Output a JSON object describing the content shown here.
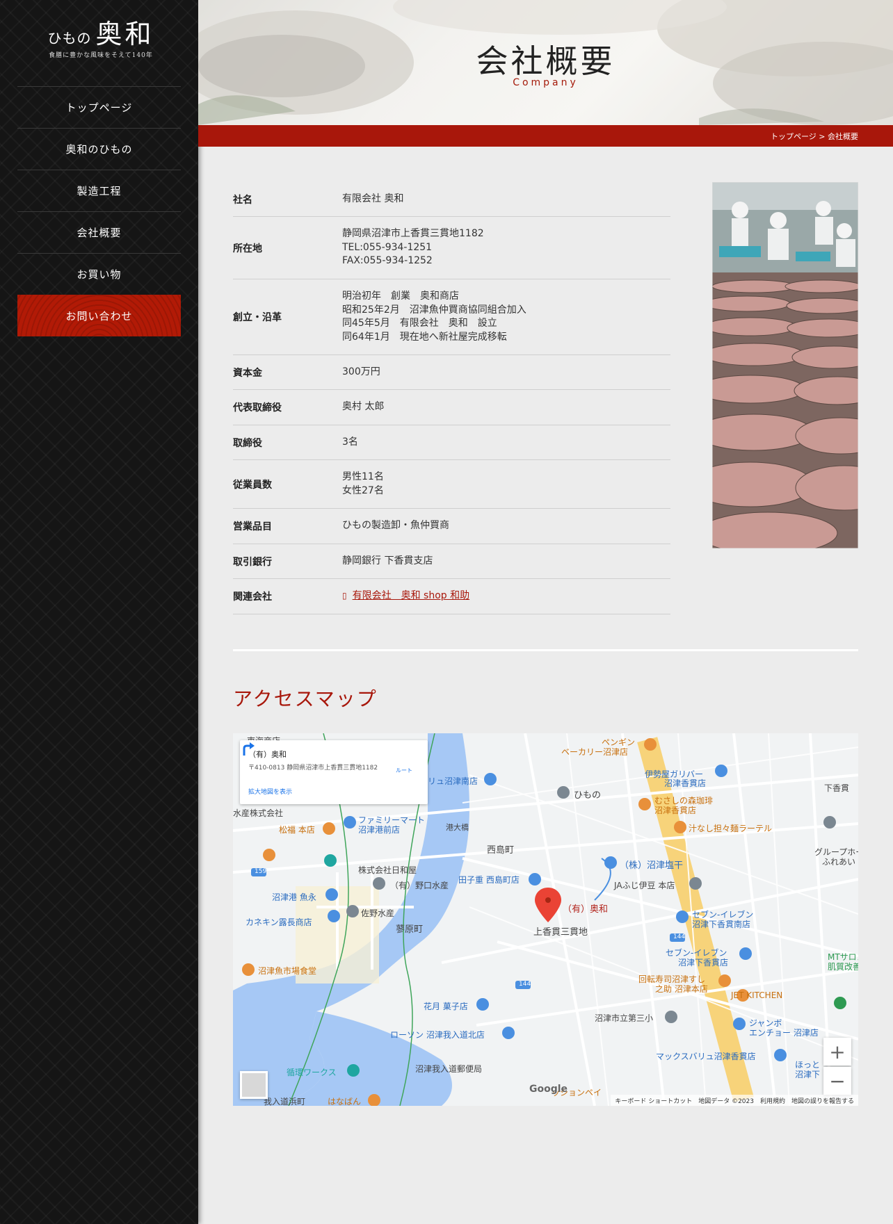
{
  "logo": {
    "prefix": "ひもの",
    "name": "奥和",
    "tagline": "食膳に豊かな風味をそえて140年"
  },
  "nav": {
    "items": [
      {
        "label": "トップページ"
      },
      {
        "label": "奥和のひもの"
      },
      {
        "label": "製造工程"
      },
      {
        "label": "会社概要"
      },
      {
        "label": "お買い物"
      }
    ],
    "contact": "お問い合わせ"
  },
  "hero": {
    "title": "会社概要",
    "subtitle": "Company"
  },
  "breadcrumb": {
    "home": "トップページ",
    "separator": ">",
    "current": "会社概要"
  },
  "company": {
    "rows": [
      {
        "label": "社名",
        "lines": [
          "有限会社 奥和"
        ]
      },
      {
        "label": "所在地",
        "lines": [
          "静岡県沼津市上香貫三貫地1182",
          "TEL:055-934-1251",
          "FAX:055-934-1252"
        ]
      },
      {
        "label": "創立・沿革",
        "lines": [
          "明治初年　創業　奥和商店",
          "昭和25年2月　沼津魚仲買商協同組合加入",
          "同45年5月　有限会社　奥和　設立",
          "同64年1月　現在地へ新社屋完成移転"
        ]
      },
      {
        "label": "資本金",
        "lines": [
          "300万円"
        ]
      },
      {
        "label": "代表取締役",
        "lines": [
          "奥村 太郎"
        ]
      },
      {
        "label": "取締役",
        "lines": [
          "3名"
        ]
      },
      {
        "label": "従業員数",
        "lines": [
          "男性11名",
          "女性27名"
        ]
      },
      {
        "label": "営業品目",
        "lines": [
          "ひもの製造卸・魚仲買商"
        ]
      },
      {
        "label": "取引銀行",
        "lines": [
          "静岡銀行 下香貫支店"
        ]
      },
      {
        "label": "関連会社",
        "link": "有限会社　奥和 shop 和助",
        "icon": "external-link-icon"
      }
    ]
  },
  "access": {
    "title": "アクセスマップ"
  },
  "map": {
    "card": {
      "title": "（有）奥和",
      "address": "〒410-0813 静岡県沼津市上香貫三貫地1182",
      "route_label": "ルート",
      "more_link": "拡大地図を表示"
    },
    "labels": {
      "okuwa": "（有）奥和",
      "kamikanuki": "上香貫三貫地",
      "nishijima": "西島町",
      "yonbara": "蓼原町",
      "minatoohashi": "港大橋",
      "himono": "ひもの",
      "shiohi": "（株）沼津塩干",
      "ja": "JAふじ伊豆 本店",
      "seven1": "セブン-イレブン",
      "seven1b": "沼津下香貫南店",
      "seven2": "セブン-イレブン",
      "seven2b": "沼津下香貫店",
      "kaiten": "回転寿司沼津すし",
      "kaitenb": "之助 沼津本店",
      "jet": "JET KITCHEN",
      "jumbo": "ジャンボ",
      "jumbob": "エンチョー 沼津店",
      "maxvalu": "マックスバリュ沼津香貫店",
      "school": "沼津市立第三小",
      "lawson": "ローソン 沼津我入道北店",
      "hanatsuki": "花月 菓子店",
      "post": "沼津我入道郵便局",
      "junkan": "循環ワークス",
      "hamamachi": "我入道浜町",
      "hanaban": "はなばん",
      "shokudo": "沼津魚市場食堂",
      "kanekin": "カネキン露長商店",
      "uonaga": "沼津港 魚永",
      "sano": "佐野水産",
      "hiwaya": "株式会社日和屋",
      "noguchi": "（有）野口水産",
      "tagoju": "田子重 西島町店",
      "family": "ファミリーマート",
      "familyb": "沼津港前店",
      "matsufuku": "松福 本店",
      "suisan": "水産株式会社",
      "penguin": "ペンギン",
      "penguinb": "ベーカリー沼津店",
      "iseya": "伊勢屋ガリバー",
      "iseyab": "沼津香貫店",
      "mori": "むさしの森珈琲",
      "morib": "沼津香貫店",
      "shirunashi": "汁なし担々麺ラーテル",
      "shimokanuki": "下香貫",
      "group": "グループホーム",
      "groupb": "ふれあい",
      "mt": "MTサロン",
      "mtb": "肌質改善",
      "hotto": "ほっと",
      "hottob": "沼津下",
      "minamiten": "リュ沼津南店",
      "route159": "159",
      "route144a": "144",
      "route144b": "144",
      "sengentaku": "東海商店",
      "cashless": "ッションペイ"
    },
    "zoom_in": "+",
    "zoom_out": "−",
    "google": "Google",
    "footer": "キーボード ショートカット　地図データ ©2023　利用規約　地図の誤りを報告する"
  }
}
